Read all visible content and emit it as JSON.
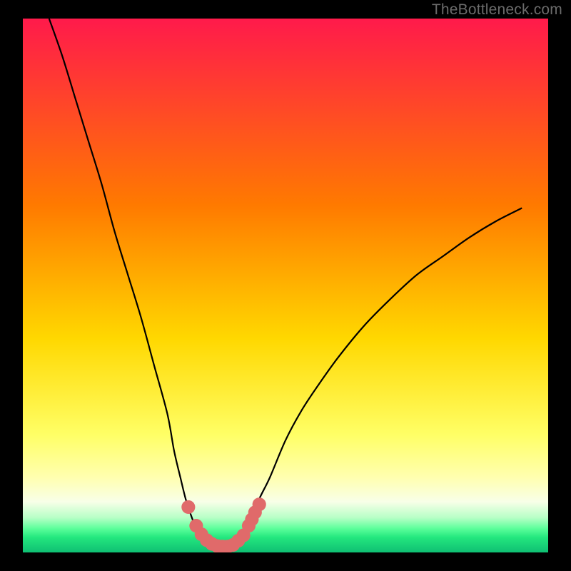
{
  "watermark": "TheBottleneck.com",
  "chart_data": {
    "type": "line",
    "title": "",
    "xlabel": "",
    "ylabel": "",
    "xlim": [
      0,
      100
    ],
    "ylim": [
      0,
      100
    ],
    "frame": {
      "x": 4.0,
      "y": 3.25,
      "w": 92.0,
      "h": 93.5
    },
    "gradient_stops": [
      {
        "offset": 0.0,
        "color": "#ff1a4b"
      },
      {
        "offset": 0.35,
        "color": "#ff7a00"
      },
      {
        "offset": 0.6,
        "color": "#ffd800"
      },
      {
        "offset": 0.78,
        "color": "#ffff66"
      },
      {
        "offset": 0.86,
        "color": "#ffffb0"
      },
      {
        "offset": 0.905,
        "color": "#f8ffe8"
      },
      {
        "offset": 0.935,
        "color": "#b7ffc6"
      },
      {
        "offset": 0.955,
        "color": "#5dff9b"
      },
      {
        "offset": 0.972,
        "color": "#23e77e"
      },
      {
        "offset": 1.0,
        "color": "#0fbf73"
      }
    ],
    "axes_color": "#000000",
    "curve_color": "#000000",
    "series": [
      {
        "name": "bottleneck-curve",
        "x": [
          5.0,
          7.5,
          10.0,
          12.5,
          15.0,
          17.5,
          20.0,
          22.5,
          25.0,
          27.5,
          28.8,
          30.0,
          31.0,
          32.0,
          33.0,
          34.0,
          35.0,
          36.0,
          37.0,
          38.0,
          39.0,
          40.0,
          41.0,
          42.0,
          43.5,
          45.0,
          47.0,
          50.0,
          53.0,
          56.0,
          60.0,
          65.0,
          70.0,
          75.0,
          80.0,
          85.0,
          90.0,
          95.0
        ],
        "y": [
          100.0,
          93.0,
          85.0,
          77.0,
          69.0,
          60.0,
          52.0,
          44.0,
          35.0,
          26.0,
          19.0,
          14.0,
          10.0,
          7.0,
          4.5,
          3.0,
          2.0,
          1.3,
          1.0,
          1.0,
          1.0,
          1.2,
          1.8,
          3.0,
          6.0,
          10.0,
          14.0,
          21.0,
          26.5,
          31.0,
          36.5,
          42.5,
          47.5,
          52.0,
          55.5,
          59.0,
          62.0,
          64.5
        ]
      }
    ],
    "markers": {
      "color": "#e06a6a",
      "radius": 1.3,
      "points": [
        {
          "x": 31.5,
          "y": 8.5
        },
        {
          "x": 33.0,
          "y": 5.0
        },
        {
          "x": 34.0,
          "y": 3.4
        },
        {
          "x": 35.0,
          "y": 2.3
        },
        {
          "x": 36.0,
          "y": 1.6
        },
        {
          "x": 37.0,
          "y": 1.2
        },
        {
          "x": 38.0,
          "y": 1.1
        },
        {
          "x": 39.0,
          "y": 1.1
        },
        {
          "x": 40.0,
          "y": 1.4
        },
        {
          "x": 41.0,
          "y": 2.2
        },
        {
          "x": 42.0,
          "y": 3.2
        },
        {
          "x": 43.0,
          "y": 5.0
        },
        {
          "x": 43.6,
          "y": 6.2
        },
        {
          "x": 44.2,
          "y": 7.5
        },
        {
          "x": 45.0,
          "y": 9.0
        }
      ]
    }
  }
}
